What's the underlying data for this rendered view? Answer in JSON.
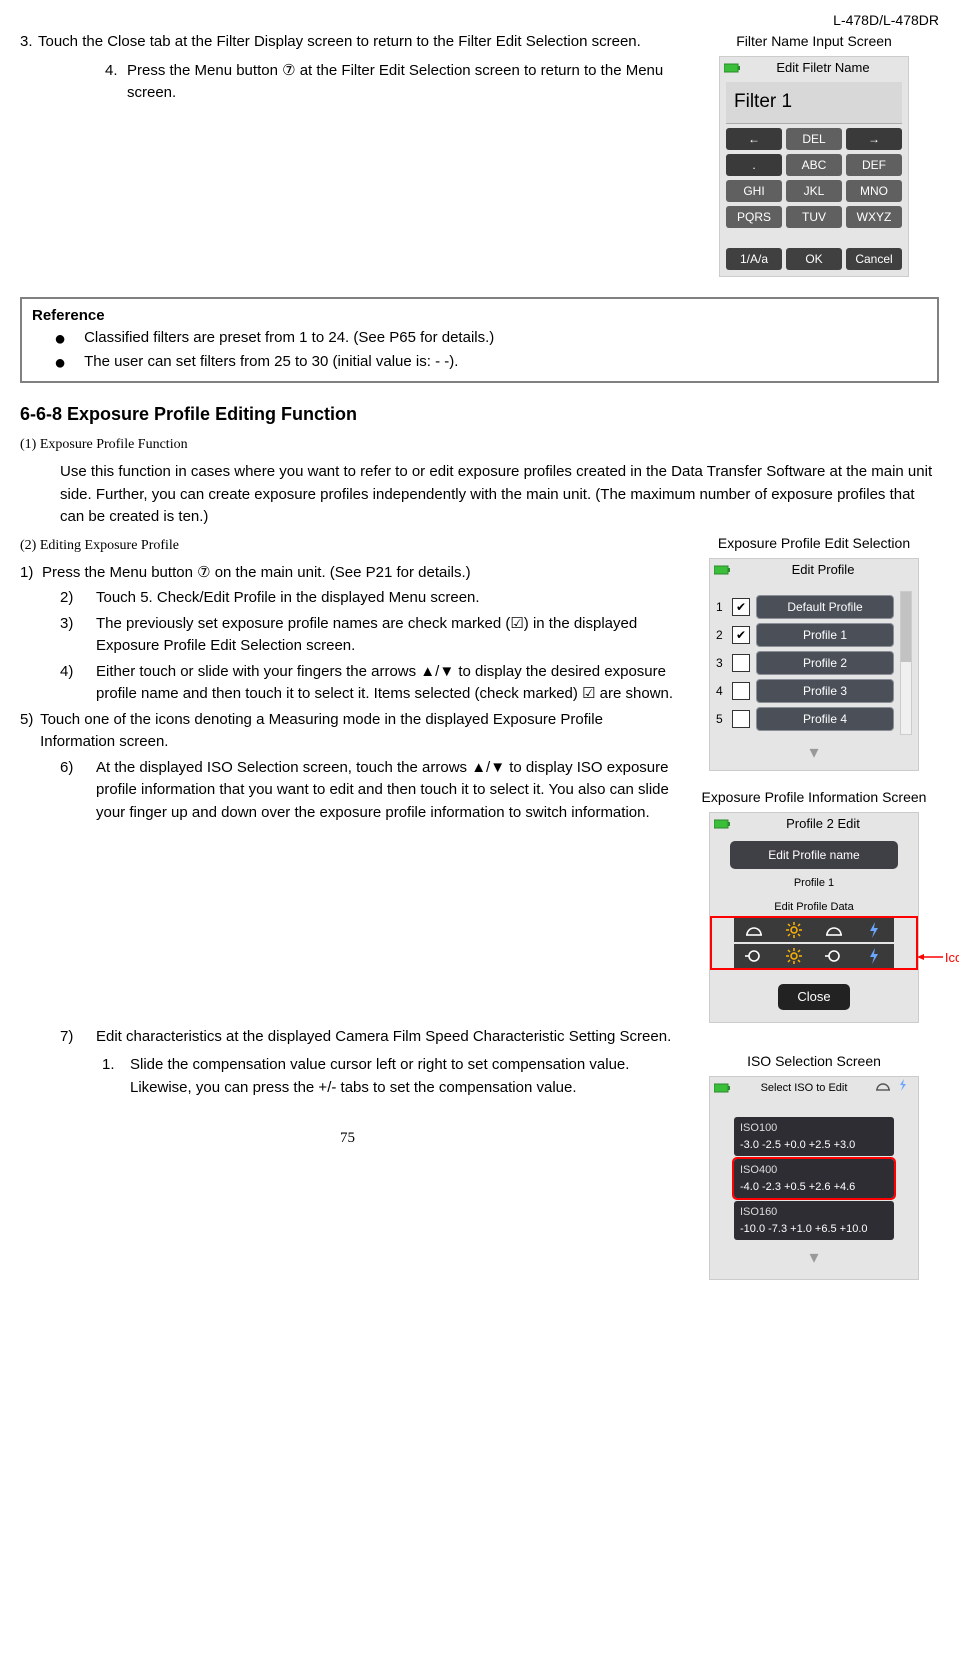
{
  "meta": {
    "model": "L-478D/L-478DR"
  },
  "step3": "Touch the Close tab at the Filter Display screen to return to the Filter Edit Selection screen.",
  "step4": "Press the Menu button ⑦ at the Filter Edit Selection screen to return to the Menu screen.",
  "step3_num": "3.",
  "step4_num": "4.",
  "filter_caption": "Filter Name Input Screen",
  "filter": {
    "title": "Edit Filetr Name",
    "name": "Filter 1",
    "keys": [
      "←",
      "DEL",
      "→",
      ".",
      "ABC",
      "DEF",
      "GHI",
      "JKL",
      "MNO",
      "PQRS",
      "TUV",
      "WXYZ"
    ],
    "bottom": [
      "1/A/a",
      "OK",
      "Cancel"
    ]
  },
  "reference": {
    "title": "Reference",
    "items": [
      "Classified filters are preset from 1 to 24. (See P65 for details.)",
      "The user can set filters from 25 to 30 (initial value is: - -)."
    ]
  },
  "heading": "6-6-8 Exposure Profile Editing Function",
  "sub1": "(1) Exposure Profile Function",
  "sub1_body": "Use this function in cases where you want to refer to or edit exposure profiles created in the Data Transfer Software at the main unit side. Further, you can create exposure profiles independently with the main unit. (The maximum number of exposure profiles that can be created is ten.)",
  "sub2": "(2) Editing Exposure Profile",
  "edit_caption": "Exposure Profile Edit Selection",
  "steps2": {
    "s1": "Press the Menu button ⑦ on the main unit. (See P21 for details.)",
    "s2": "Touch 5. Check/Edit Profile in the displayed Menu screen.",
    "s3": "The previously set exposure profile names are check marked (☑) in the displayed Exposure Profile Edit Selection screen.",
    "s4": "Either touch or slide with your fingers the arrows ▲/▼ to display the desired exposure profile name and then touch it to select it. Items selected (check marked) ☑ are shown.",
    "s5": "Touch one of the icons denoting a Measuring mode in the displayed Exposure Profile Information screen.",
    "s6": "At the displayed ISO Selection screen, touch the arrows ▲/▼ to display ISO exposure profile information that you want to edit and then touch it to select it. You also can slide your finger up and down over the exposure profile information to switch information.",
    "s7": "Edit characteristics at the displayed Camera Film Speed Characteristic Setting Screen.",
    "s7_1": "Slide the compensation value cursor left or right to set compensation value. Likewise, you can press the +/- tabs to set the compensation value."
  },
  "nums": {
    "n1": "1)",
    "n2": "2)",
    "n3": "3)",
    "n4": "4)",
    "n5": "5)",
    "n6": "6)",
    "n7": "7)",
    "n7_1": "1."
  },
  "profile_list": {
    "title": "Edit Profile",
    "rows": [
      {
        "n": "1",
        "checked": true,
        "label": "Default Profile"
      },
      {
        "n": "2",
        "checked": true,
        "label": "Profile 1"
      },
      {
        "n": "3",
        "checked": false,
        "label": "Profile 2"
      },
      {
        "n": "4",
        "checked": false,
        "label": "Profile 3"
      },
      {
        "n": "5",
        "checked": false,
        "label": "Profile 4"
      }
    ]
  },
  "info_caption": "Exposure Profile Information Screen",
  "info": {
    "title": "Profile 2 Edit",
    "btn_name": "Edit Profile name",
    "sub": "Profile 1",
    "data_label": "Edit Profile Data",
    "close": "Close"
  },
  "icons_label": "Icons",
  "iso_caption": "ISO Selection Screen",
  "iso": {
    "title": "Select ISO to Edit",
    "rows": [
      {
        "name": "ISO100",
        "vals": "-3.0  -2.5  +0.0  +2.5  +3.0",
        "sel": false
      },
      {
        "name": "ISO400",
        "vals": "-4.0  -2.3  +0.5  +2.6  +4.6",
        "sel": true
      },
      {
        "name": "ISO160",
        "vals": "-10.0 -7.3  +1.0  +6.5 +10.0",
        "sel": false
      }
    ]
  },
  "page": "75"
}
